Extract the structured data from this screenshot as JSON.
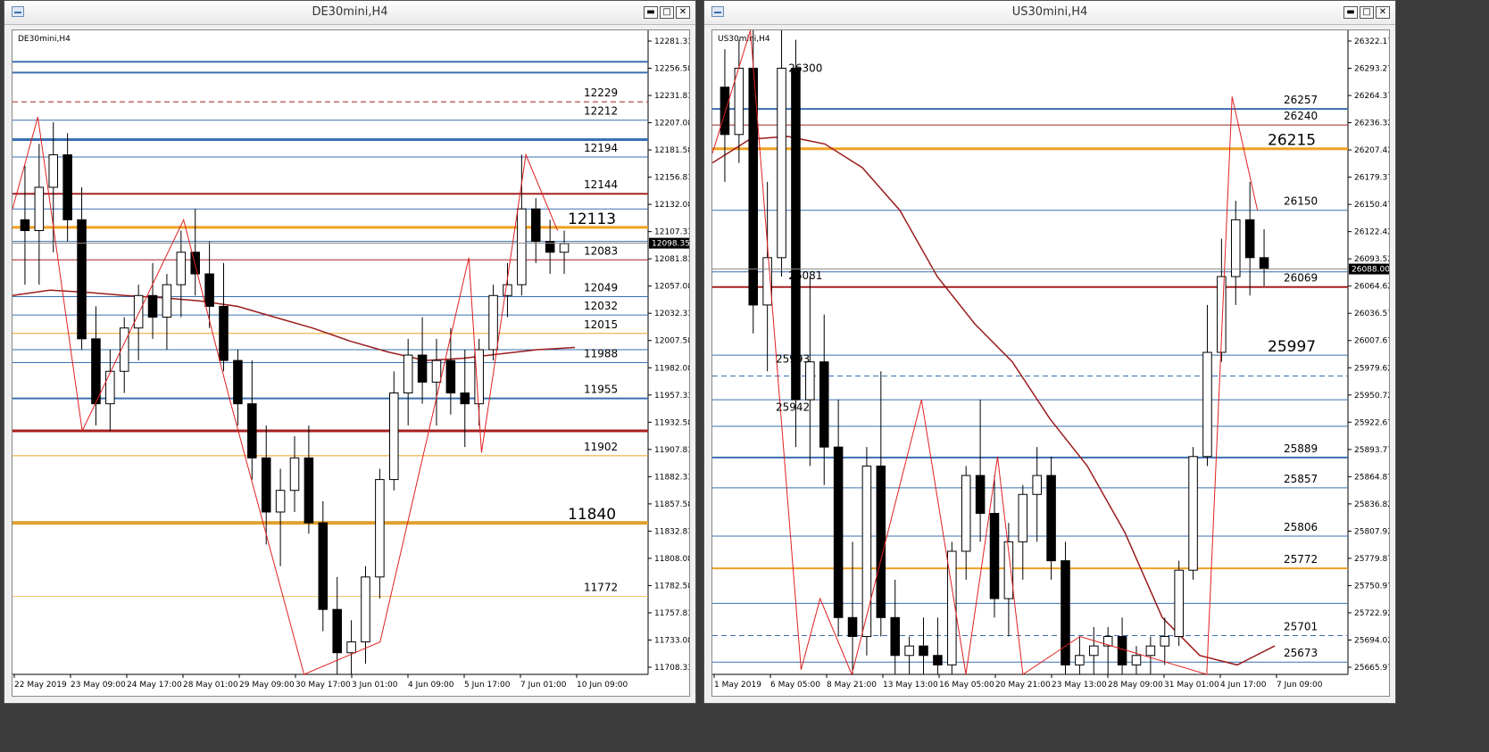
{
  "windows": [
    {
      "title": "DE30mini,H4",
      "btn_min": "▬",
      "btn_max": "□",
      "btn_close": "✕"
    },
    {
      "title": "US30mini,H4",
      "btn_min": "▬",
      "btn_max": "□",
      "btn_close": "✕"
    }
  ],
  "chart_data": [
    {
      "type": "candlestick",
      "symbol_label": "DE30mini,H4",
      "ylim": [
        11700,
        12295
      ],
      "y_ticks": [
        "12281.33",
        "12256.58",
        "12231.83",
        "12207.08",
        "12181.58",
        "12156.83",
        "12132.08",
        "12107.33",
        "12081.83",
        "12057.08",
        "12032.33",
        "12007.58",
        "11982.08",
        "11957.33",
        "11932.58",
        "11907.83",
        "11882.33",
        "11857.58",
        "11832.83",
        "11808.08",
        "11782.58",
        "11757.83",
        "11733.08",
        "11708.33"
      ],
      "x_ticks": [
        "22 May 2019",
        "23 May 09:00",
        "24 May 17:00",
        "28 May 01:00",
        "29 May 09:00",
        "30 May 17:00",
        "3 Jun 01:00",
        "4 Jun 09:00",
        "5 Jun 17:00",
        "7 Jun 01:00",
        "10 Jun 09:00"
      ],
      "current_price": "12098.35",
      "level_lines": [
        {
          "price": 12266,
          "color": "#3a6fb0",
          "width": 2
        },
        {
          "price": 12256,
          "color": "#3a6fb0",
          "width": 2
        },
        {
          "price": 12229,
          "color": "#a52020",
          "width": 1,
          "dash": true,
          "label": "12229"
        },
        {
          "price": 12212,
          "color": "#3a6fb0",
          "width": 1,
          "label": "12212"
        },
        {
          "price": 12194,
          "color": "#3a6fb0",
          "width": 3
        },
        {
          "price": 12178,
          "color": "#3a6fb0",
          "width": 1,
          "label": "12194"
        },
        {
          "price": 12144,
          "color": "#a52020",
          "width": 2,
          "label": "12144"
        },
        {
          "price": 12130,
          "color": "#3a6fb0",
          "width": 1
        },
        {
          "price": 12113,
          "color": "#f0a020",
          "width": 3,
          "label": "12113",
          "big": true
        },
        {
          "price": 12100,
          "color": "#3a6fb0",
          "width": 1
        },
        {
          "price": 12083,
          "color": "#a52020",
          "width": 1,
          "label": "12083"
        },
        {
          "price": 12049,
          "color": "#3a6fb0",
          "width": 1,
          "label": "12049"
        },
        {
          "price": 12032,
          "color": "#3a6fb0",
          "width": 1,
          "label": "12032"
        },
        {
          "price": 12015,
          "color": "#f0a020",
          "width": 1,
          "label": "12015"
        },
        {
          "price": 12000,
          "color": "#3a6fb0",
          "width": 1
        },
        {
          "price": 11988,
          "color": "#3a6fb0",
          "width": 1,
          "label": "11988"
        },
        {
          "price": 11955,
          "color": "#3a6fb0",
          "width": 2,
          "label": "11955"
        },
        {
          "price": 11925,
          "color": "#a52020",
          "width": 3
        },
        {
          "price": 11902,
          "color": "#f0a020",
          "width": 1,
          "label": "11902"
        },
        {
          "price": 11840,
          "color": "#e0a030",
          "width": 4,
          "label": "11840",
          "big": true
        },
        {
          "price": 11772,
          "color": "#f0c060",
          "width": 1,
          "label": "11772"
        }
      ],
      "ma": [
        12050,
        12055,
        12053,
        12050,
        12048,
        12045,
        12040,
        12030,
        12020,
        12008,
        11998,
        11990,
        11992,
        11996,
        12000,
        12002
      ],
      "zigzag": [
        [
          0.0,
          12130
        ],
        [
          0.04,
          12215
        ],
        [
          0.11,
          11925
        ],
        [
          0.27,
          12120
        ],
        [
          0.34,
          11960
        ],
        [
          0.46,
          11700
        ],
        [
          0.58,
          11730
        ],
        [
          0.72,
          12085
        ],
        [
          0.74,
          11905
        ],
        [
          0.81,
          12180
        ],
        [
          0.86,
          12110
        ]
      ],
      "candles": [
        [
          12120,
          12170,
          12060,
          12110
        ],
        [
          12110,
          12190,
          12060,
          12150
        ],
        [
          12150,
          12210,
          12090,
          12180
        ],
        [
          12180,
          12200,
          12100,
          12120
        ],
        [
          12120,
          12150,
          12000,
          12010
        ],
        [
          12010,
          12040,
          11930,
          11950
        ],
        [
          11950,
          12000,
          11925,
          11980
        ],
        [
          11980,
          12030,
          11960,
          12020
        ],
        [
          12020,
          12060,
          11990,
          12050
        ],
        [
          12050,
          12080,
          12010,
          12030
        ],
        [
          12030,
          12070,
          12000,
          12060
        ],
        [
          12060,
          12110,
          12030,
          12090
        ],
        [
          12090,
          12130,
          12050,
          12070
        ],
        [
          12070,
          12100,
          12020,
          12040
        ],
        [
          12040,
          12080,
          11980,
          11990
        ],
        [
          11990,
          12000,
          11930,
          11950
        ],
        [
          11950,
          11990,
          11880,
          11900
        ],
        [
          11900,
          11930,
          11820,
          11850
        ],
        [
          11850,
          11890,
          11800,
          11870
        ],
        [
          11870,
          11920,
          11850,
          11900
        ],
        [
          11900,
          11930,
          11830,
          11840
        ],
        [
          11840,
          11860,
          11740,
          11760
        ],
        [
          11760,
          11790,
          11700,
          11720
        ],
        [
          11720,
          11750,
          11700,
          11730
        ],
        [
          11730,
          11800,
          11710,
          11790
        ],
        [
          11790,
          11890,
          11770,
          11880
        ],
        [
          11880,
          11980,
          11870,
          11960
        ],
        [
          11960,
          12010,
          11930,
          11995
        ],
        [
          11995,
          12030,
          11950,
          11970
        ],
        [
          11970,
          12010,
          11930,
          11990
        ],
        [
          11990,
          12020,
          11940,
          11960
        ],
        [
          11960,
          12000,
          11910,
          11950
        ],
        [
          11950,
          12010,
          11930,
          12000
        ],
        [
          12000,
          12060,
          11990,
          12050
        ],
        [
          12050,
          12080,
          12030,
          12060
        ],
        [
          12060,
          12180,
          12050,
          12130
        ],
        [
          12130,
          12140,
          12080,
          12100
        ],
        [
          12100,
          12120,
          12070,
          12090
        ],
        [
          12090,
          12110,
          12070,
          12098
        ]
      ]
    },
    {
      "type": "candlestick",
      "symbol_label": "US30mini,H4",
      "ylim": [
        25660,
        26340
      ],
      "y_ticks": [
        "26322.17",
        "26293.27",
        "26264.37",
        "26236.32",
        "26207.42",
        "26179.37",
        "26150.47",
        "26122.42",
        "26093.52",
        "26064.62",
        "26036.57",
        "26007.67",
        "25979.62",
        "25950.72",
        "25922.67",
        "25893.77",
        "25864.87",
        "25836.82",
        "25807.92",
        "25779.87",
        "25750.97",
        "25722.92",
        "25694.02",
        "25665.97"
      ],
      "x_ticks": [
        "1 May 2019",
        "6 May 05:00",
        "8 May 21:00",
        "13 May 13:00",
        "16 May 05:00",
        "20 May 21:00",
        "23 May 13:00",
        "28 May 09:00",
        "31 May 01:00",
        "4 Jun 17:00",
        "7 Jun 09:00"
      ],
      "current_price": "26088.00",
      "level_lines": [
        {
          "price": 26257,
          "color": "#3a6fb0",
          "width": 2,
          "label": "26257"
        },
        {
          "price": 26240,
          "color": "#a52020",
          "width": 1,
          "label": "26240"
        },
        {
          "price": 26215,
          "color": "#f0a020",
          "width": 3,
          "label": "26215",
          "big": true
        },
        {
          "price": 26150,
          "color": "#3a6fb0",
          "width": 1,
          "label": "26150"
        },
        {
          "price": 26085,
          "color": "#3a6fb0",
          "width": 1
        },
        {
          "price": 26069,
          "color": "#a52020",
          "width": 2,
          "label": "26069"
        },
        {
          "price": 25997,
          "color": "#3a6fb0",
          "width": 1,
          "label": "25997",
          "big": true
        },
        {
          "price": 25975,
          "color": "#3a6fb0",
          "width": 1,
          "dash": true
        },
        {
          "price": 25950,
          "color": "#3a6fb0",
          "width": 1
        },
        {
          "price": 25922,
          "color": "#3a6fb0",
          "width": 1
        },
        {
          "price": 25889,
          "color": "#3a6fb0",
          "width": 2,
          "label": "25889"
        },
        {
          "price": 25857,
          "color": "#3a6fb0",
          "width": 1,
          "label": "25857"
        },
        {
          "price": 25806,
          "color": "#3a6fb0",
          "width": 1,
          "label": "25806"
        },
        {
          "price": 25772,
          "color": "#f0a020",
          "width": 2,
          "label": "25772"
        },
        {
          "price": 25735,
          "color": "#3a6fb0",
          "width": 1
        },
        {
          "price": 25701,
          "color": "#3a6fb0",
          "width": 1,
          "dash": true,
          "label": "25701"
        },
        {
          "price": 25673,
          "color": "#3a6fb0",
          "width": 1,
          "label": "25673"
        }
      ],
      "side_labels": [
        {
          "text": "26300",
          "x": 0.12,
          "price": 26300
        },
        {
          "text": "26081",
          "x": 0.12,
          "price": 26081
        },
        {
          "text": "25993",
          "x": 0.1,
          "price": 25993
        },
        {
          "text": "25942",
          "x": 0.1,
          "price": 25942
        }
      ],
      "ma": [
        26200,
        26225,
        26228,
        26220,
        26195,
        26150,
        26080,
        26030,
        25990,
        25930,
        25880,
        25810,
        25720,
        25680,
        25670,
        25690
      ],
      "zigzag": [
        [
          0.0,
          26210
        ],
        [
          0.06,
          26340
        ],
        [
          0.14,
          25665
        ],
        [
          0.17,
          25740
        ],
        [
          0.22,
          25660
        ],
        [
          0.33,
          25950
        ],
        [
          0.4,
          25660
        ],
        [
          0.45,
          25890
        ],
        [
          0.49,
          25660
        ],
        [
          0.58,
          25700
        ],
        [
          0.78,
          25660
        ],
        [
          0.82,
          26270
        ],
        [
          0.86,
          26150
        ]
      ],
      "candles": [
        [
          26280,
          26320,
          26180,
          26230
        ],
        [
          26230,
          26330,
          26200,
          26300
        ],
        [
          26300,
          26340,
          26020,
          26050
        ],
        [
          26050,
          26180,
          25980,
          26100
        ],
        [
          26100,
          26340,
          26080,
          26300
        ],
        [
          26300,
          26330,
          25900,
          25950
        ],
        [
          25950,
          26080,
          25880,
          25990
        ],
        [
          25990,
          26040,
          25860,
          25900
        ],
        [
          25900,
          25950,
          25700,
          25720
        ],
        [
          25720,
          25800,
          25660,
          25700
        ],
        [
          25700,
          25900,
          25680,
          25880
        ],
        [
          25880,
          25980,
          25700,
          25720
        ],
        [
          25720,
          25760,
          25660,
          25680
        ],
        [
          25680,
          25700,
          25660,
          25690
        ],
        [
          25690,
          25720,
          25660,
          25680
        ],
        [
          25680,
          25720,
          25660,
          25670
        ],
        [
          25670,
          25800,
          25660,
          25790
        ],
        [
          25790,
          25880,
          25760,
          25870
        ],
        [
          25870,
          25950,
          25800,
          25830
        ],
        [
          25830,
          25870,
          25720,
          25740
        ],
        [
          25740,
          25820,
          25700,
          25800
        ],
        [
          25800,
          25860,
          25760,
          25850
        ],
        [
          25850,
          25900,
          25800,
          25870
        ],
        [
          25870,
          25890,
          25760,
          25780
        ],
        [
          25780,
          25800,
          25660,
          25670
        ],
        [
          25670,
          25700,
          25660,
          25680
        ],
        [
          25680,
          25710,
          25660,
          25690
        ],
        [
          25690,
          25710,
          25660,
          25700
        ],
        [
          25700,
          25720,
          25660,
          25670
        ],
        [
          25670,
          25690,
          25660,
          25680
        ],
        [
          25680,
          25700,
          25660,
          25690
        ],
        [
          25690,
          25720,
          25670,
          25700
        ],
        [
          25700,
          25780,
          25690,
          25770
        ],
        [
          25770,
          25900,
          25760,
          25890
        ],
        [
          25890,
          26050,
          25880,
          26000
        ],
        [
          26000,
          26120,
          25990,
          26080
        ],
        [
          26080,
          26160,
          26050,
          26140
        ],
        [
          26140,
          26180,
          26060,
          26100
        ],
        [
          26100,
          26130,
          26070,
          26088
        ]
      ]
    }
  ]
}
